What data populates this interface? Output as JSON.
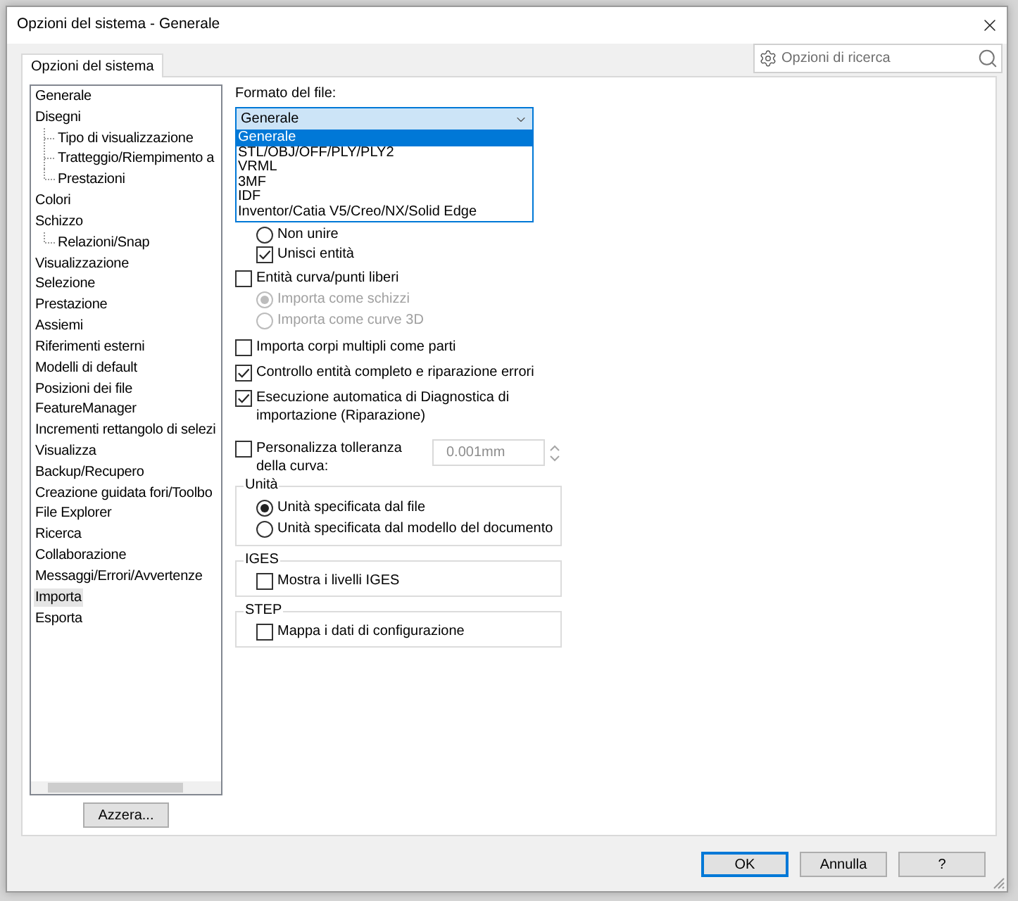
{
  "window": {
    "title": "Opzioni del sistema - Generale"
  },
  "tabs": [
    {
      "label": "Opzioni del sistema",
      "selected": true
    }
  ],
  "search": {
    "placeholder": "Opzioni di ricerca"
  },
  "sidebar": {
    "items": [
      {
        "label": "Generale",
        "selected": false
      },
      {
        "label": "Disegni",
        "selected": false,
        "children": [
          {
            "label": "Tipo di visualizzazione",
            "selected": false
          },
          {
            "label": "Tratteggio/Riempimento a",
            "selected": false
          },
          {
            "label": "Prestazioni",
            "selected": false
          }
        ]
      },
      {
        "label": "Colori",
        "selected": false
      },
      {
        "label": "Schizzo",
        "selected": false,
        "children": [
          {
            "label": "Relazioni/Snap",
            "selected": false
          }
        ]
      },
      {
        "label": "Visualizzazione",
        "selected": false
      },
      {
        "label": "Selezione",
        "selected": false
      },
      {
        "label": "Prestazione",
        "selected": false
      },
      {
        "label": "Assiemi",
        "selected": false
      },
      {
        "label": "Riferimenti esterni",
        "selected": false
      },
      {
        "label": "Modelli di default",
        "selected": false
      },
      {
        "label": "Posizioni dei file",
        "selected": false
      },
      {
        "label": "FeatureManager",
        "selected": false
      },
      {
        "label": "Incrementi rettangolo di selezi",
        "selected": false
      },
      {
        "label": "Visualizza",
        "selected": false
      },
      {
        "label": "Backup/Recupero",
        "selected": false
      },
      {
        "label": "Creazione guidata fori/Toolbo",
        "selected": false
      },
      {
        "label": "File Explorer",
        "selected": false
      },
      {
        "label": "Ricerca",
        "selected": false
      },
      {
        "label": "Collaborazione",
        "selected": false
      },
      {
        "label": "Messaggi/Errori/Avvertenze",
        "selected": false
      },
      {
        "label": "Importa",
        "selected": true
      },
      {
        "label": "Esporta",
        "selected": false
      }
    ],
    "reset_button": "Azzera..."
  },
  "file_format": {
    "label": "Formato del file:",
    "value": "Generale",
    "expanded": true,
    "options": [
      {
        "label": "Generale",
        "selected": true
      },
      {
        "label": "STL/OBJ/OFF/PLY/PLY2",
        "selected": false
      },
      {
        "label": "VRML",
        "selected": false
      },
      {
        "label": "3MF",
        "selected": false
      },
      {
        "label": "IDF",
        "selected": false
      },
      {
        "label": "Inventor/Catia V5/Creo/NX/Solid Edge",
        "selected": false
      }
    ]
  },
  "merge_options": [
    {
      "kind": "radio",
      "label": "Non unire",
      "selected": false
    },
    {
      "kind": "checkbox",
      "label": "Unisci entità",
      "checked": true
    }
  ],
  "options": [
    {
      "kind": "checkbox",
      "label": "Entità curva/punti liberi",
      "checked": false,
      "children": [
        {
          "kind": "radio",
          "label": "Importa come schizzi",
          "selected": true,
          "disabled": true
        },
        {
          "kind": "radio",
          "label": "Importa come curve 3D",
          "selected": false,
          "disabled": true
        }
      ]
    },
    {
      "kind": "checkbox",
      "label": "Importa corpi multipli come parti",
      "checked": false
    },
    {
      "kind": "checkbox",
      "label": "Controllo entità completo e riparazione errori",
      "checked": true
    },
    {
      "kind": "checkbox",
      "label": "Esecuzione automatica di Diagnostica di importazione (Riparazione)",
      "checked": true
    },
    {
      "kind": "tolerance",
      "label": "Personalizza tolleranza della curva:",
      "checked": false,
      "field": {
        "value": "0.001mm",
        "disabled": true
      }
    }
  ],
  "groups": [
    {
      "title": "Unità",
      "items": [
        {
          "kind": "radio",
          "label": "Unità specificata dal file",
          "selected": true
        },
        {
          "kind": "radio",
          "label": "Unità specificata dal modello del documento",
          "selected": false
        }
      ]
    },
    {
      "title": "IGES",
      "items": [
        {
          "kind": "checkbox",
          "label": "Mostra i livelli IGES",
          "checked": false
        }
      ]
    },
    {
      "title": "STEP",
      "items": [
        {
          "kind": "checkbox",
          "label": "Mappa i dati di configurazione",
          "checked": false
        }
      ]
    }
  ],
  "buttons": [
    {
      "label": "OK",
      "default": true
    },
    {
      "label": "Annulla",
      "default": false
    },
    {
      "label": "?",
      "default": false
    }
  ]
}
